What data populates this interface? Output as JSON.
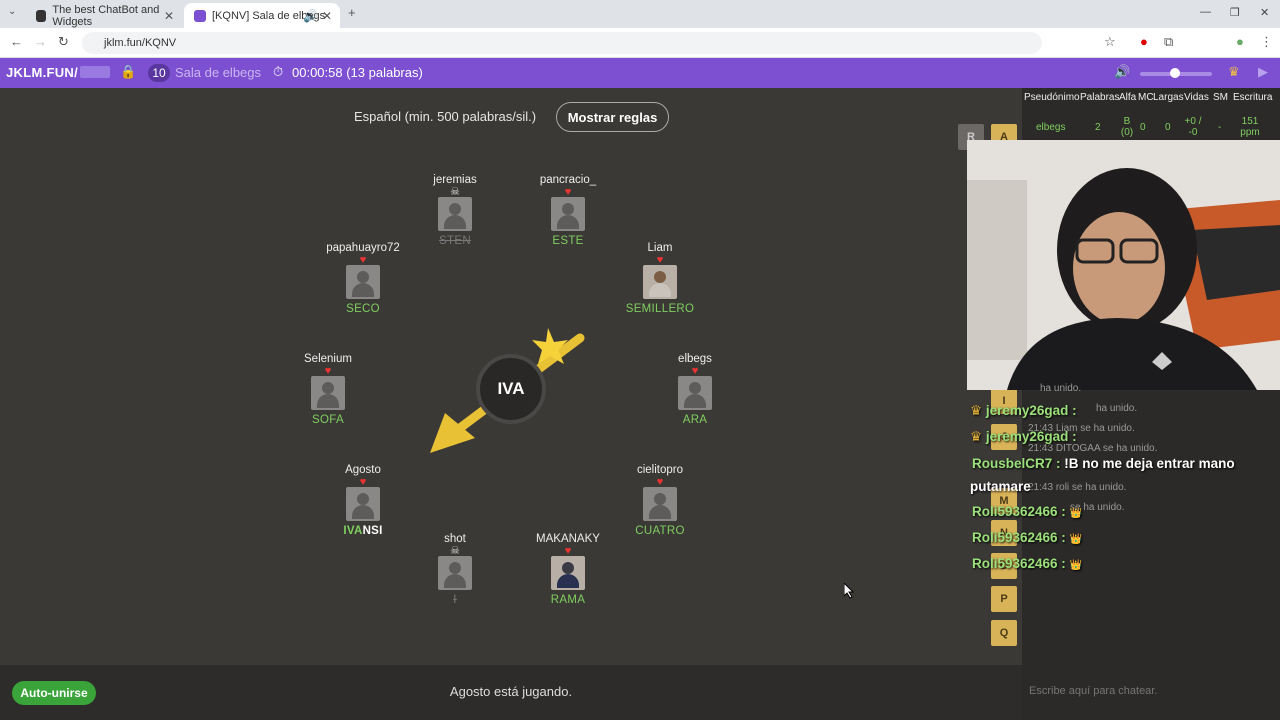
{
  "browser": {
    "tabs": [
      {
        "label": "The best ChatBot and Widgets",
        "active": false
      },
      {
        "label": "[KQNV] Sala de elbegs",
        "active": true
      }
    ],
    "url": "jklm.fun/KQNV"
  },
  "topbar": {
    "site": "JKLM.FUN/",
    "count": "10",
    "room_name": "Sala de elbegs",
    "timer": "00:00:58 (13 palabras)"
  },
  "game": {
    "rules_text": "Español (min. 500 palabras/sil.)",
    "rules_button": "Mostrar reglas",
    "syllable": "IVA",
    "players": [
      {
        "name": "jeremias",
        "word": "STEN",
        "dead": true
      },
      {
        "name": "pancracio_",
        "word": "ESTE",
        "dead": false
      },
      {
        "name": "papahuayro72",
        "word": "SECO",
        "dead": false
      },
      {
        "name": "Liam",
        "word": "SEMILLERO",
        "dead": false
      },
      {
        "name": "Selenium",
        "word": "SOFA",
        "dead": false
      },
      {
        "name": "elbegs",
        "word": "ARA",
        "dead": false
      },
      {
        "name": "Agosto",
        "word_hl": "IVA",
        "word_rest": "NSI",
        "dead": false
      },
      {
        "name": "cielitopro",
        "word": "CUATRO",
        "dead": false
      },
      {
        "name": "shot",
        "word": "I",
        "dead": true
      },
      {
        "name": "MAKANAKY",
        "word": "RAMA",
        "dead": false
      }
    ],
    "status": "Agosto está jugando.",
    "auto_join": "Auto-unirse",
    "letters": [
      "R",
      "A",
      "I",
      "J",
      "M",
      "N",
      "O",
      "P",
      "Q"
    ]
  },
  "leaderboard": {
    "headers": [
      "Pseudónimo",
      "Palabras",
      "Alfa",
      "MC",
      "Largas",
      "Vidas",
      "SM",
      "Escritura"
    ],
    "row": {
      "name": "elbegs",
      "words": "2",
      "alfa": "B (0)",
      "mc": "0",
      "largas": "0",
      "vidas": "+0 / -0",
      "sm": "-",
      "escritura": "151 ppm"
    }
  },
  "chat": {
    "system": [
      {
        "time": "",
        "text": "ha unido."
      },
      {
        "time": "",
        "text": "ha unido."
      },
      {
        "time": "21:43",
        "text": "Liam se ha unido."
      },
      {
        "time": "21:43",
        "text": "DITOGAA se ha unido."
      },
      {
        "time": "21:43",
        "text": "roli se ha unido."
      },
      {
        "time": "",
        "text": "se ha unido."
      }
    ],
    "messages": [
      {
        "user": "jeremy26gad :",
        "text": ""
      },
      {
        "user": "jeremy26gad :",
        "text": ""
      },
      {
        "user": "RousbelCR7 :",
        "text": "!B no me deja entrar mano"
      },
      {
        "user": "",
        "text": "putamare"
      },
      {
        "user": "Roli59362466 :",
        "text": "👑"
      },
      {
        "user": "Roli59362466 :",
        "text": "👑"
      },
      {
        "user": "Roli59362466 :",
        "text": "👑"
      }
    ],
    "placeholder": "Escribe aquí para chatear."
  }
}
